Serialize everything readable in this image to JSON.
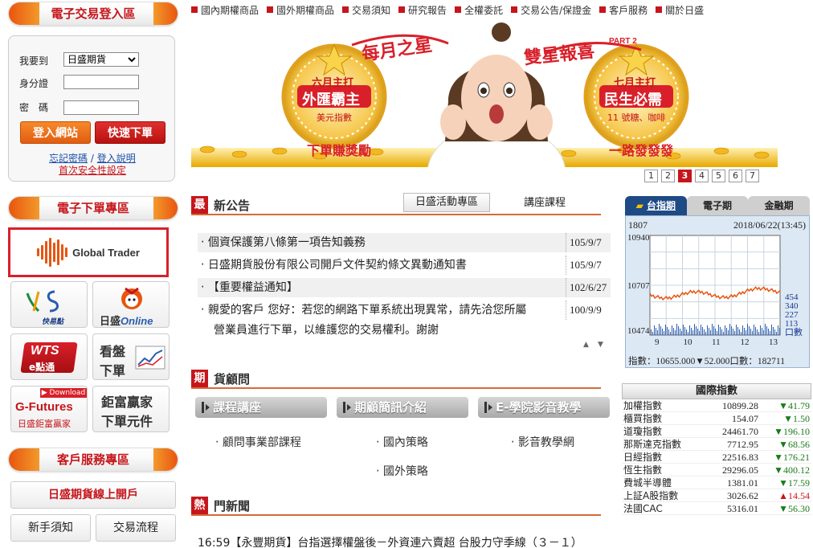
{
  "topnav": [
    "國內期權商品",
    "國外期權商品",
    "交易須知",
    "研究報告",
    "全權委託",
    "交易公告/保證金",
    "客戶服務",
    "關於日盛"
  ],
  "login": {
    "header": "電子交易登入區",
    "want_label": "我要到",
    "want_value": "日盛期貨",
    "id_label": "身分證",
    "pwd_label": "密　碼",
    "login_btn": "登入網站",
    "quick_btn": "快速下單",
    "forgot": "忘記密碼",
    "sep": "/",
    "help": "登入說明",
    "first_time": "首次安全性設定"
  },
  "eorder": {
    "header": "電子下單專區",
    "global_trader": "Global Trader",
    "hts_sub": "快易點",
    "online_brand": "日盛",
    "online_word": "Online",
    "wts_big": "WTS",
    "wts_sub": "e點通",
    "kanpan_1": "看盤",
    "kanpan_2": "下單",
    "gf_download": "Download",
    "gf_title": "G-Futures",
    "gf_sub": "日盛鉅富贏家",
    "jufu_1": "鉅富贏家",
    "jufu_2": "下單元件"
  },
  "service": {
    "header": "客戶服務專區",
    "open_account": "日盛期貨線上開戶",
    "newbie": "新手須知",
    "process": "交易流程"
  },
  "banner": {
    "title": "每月之星",
    "double": "雙星報喜",
    "part": "PART 2",
    "june_title": "六月主打",
    "june_main": "外匯霸主",
    "june_sub": "美元指數",
    "july_title": "七月主打",
    "july_main": "民生必需",
    "july_sub": "11 號糖、咖啡",
    "slogan_left": "下單賺獎勵",
    "slogan_right": "一路發發發"
  },
  "pager": [
    "1",
    "2",
    "3",
    "4",
    "5",
    "6",
    "7"
  ],
  "pager_active": "3",
  "announce": {
    "sq": "最",
    "title": "新公告",
    "tab_activity": "日盛活動專區",
    "tab_course": "講座課程",
    "items": [
      {
        "text": "個資保護第八條第一項告知義務",
        "date": "105/9/7"
      },
      {
        "text": "日盛期貨股份有限公司開戶文件契約條文異動通知書",
        "date": "105/9/7"
      },
      {
        "text": "【重要權益通知】",
        "date": "102/6/27"
      },
      {
        "text": "親愛的客戶 您好：若您的網路下單系統出現異常，請先洽您所屬",
        "date": "100/9/9"
      }
    ],
    "item4_line2": "營業員進行下單，以維護您的交易權利。謝謝"
  },
  "advisor": {
    "sq": "期",
    "title": "貨顧問",
    "buttons": [
      "課程講座",
      "期顧簡訊介紹",
      "E-學院影音教學"
    ],
    "subs": [
      "顧問事業部課程",
      "國內策略",
      "影音教學網",
      "國外策略"
    ]
  },
  "hotnews": {
    "sq": "熱",
    "title": "門新聞",
    "item": "16:59【永豐期貨】台指選擇權盤後－外資連六賣超 台股力守季線（３－１）"
  },
  "market": {
    "tabs": [
      "台指期",
      "電子期",
      "金融期"
    ],
    "code": "1807",
    "datetime": "2018/06/22(13:45)",
    "y_top": "10940",
    "y_mid": "10707",
    "y_bot": "10474",
    "x_ticks": [
      "9",
      "10",
      "11",
      "12",
      "13"
    ],
    "vol_ticks": [
      "454",
      "340",
      "227",
      "113"
    ],
    "vol_label": "口數",
    "footer": "指數：10655.000▼52.000口數：182711"
  },
  "intl": {
    "header": "國際指數",
    "rows": [
      {
        "name": "加權指數",
        "value": "10899.28",
        "change": "▼41.79",
        "dir": "down"
      },
      {
        "name": "櫃買指數",
        "value": "154.07",
        "change": "▼1.50",
        "dir": "down"
      },
      {
        "name": "道瓊指數",
        "value": "24461.70",
        "change": "▼196.10",
        "dir": "down"
      },
      {
        "name": "那斯達克指數",
        "value": "7712.95",
        "change": "▼68.56",
        "dir": "down"
      },
      {
        "name": "日經指數",
        "value": "22516.83",
        "change": "▼176.21",
        "dir": "down"
      },
      {
        "name": "恆生指數",
        "value": "29296.05",
        "change": "▼400.12",
        "dir": "down"
      },
      {
        "name": "費城半導體",
        "value": "1381.01",
        "change": "▼17.59",
        "dir": "down"
      },
      {
        "name": "上証A股指數",
        "value": "3026.62",
        "change": "▲14.54",
        "dir": "up"
      },
      {
        "name": "法國CAC",
        "value": "5316.01",
        "change": "▼56.30",
        "dir": "down"
      }
    ]
  },
  "colors": {
    "brand_red": "#c6161c",
    "brand_orange": "#e8550f",
    "gold": "#f5b800"
  }
}
